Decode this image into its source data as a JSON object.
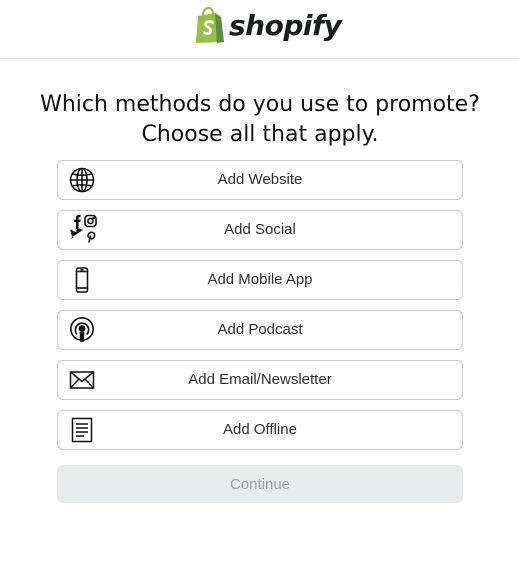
{
  "header": {
    "logo_text": "shopify"
  },
  "question": "Which methods do you use to promote? Choose all that apply.",
  "options": [
    {
      "label": "Add Website",
      "icon": "globe-icon"
    },
    {
      "label": "Add Social",
      "icon": "social-icons"
    },
    {
      "label": "Add Mobile App",
      "icon": "mobile-phone-icon"
    },
    {
      "label": "Add Podcast",
      "icon": "podcast-icon"
    },
    {
      "label": "Add Email/Newsletter",
      "icon": "envelope-icon"
    },
    {
      "label": "Add Offline",
      "icon": "document-icon"
    }
  ],
  "continue_label": "Continue",
  "colors": {
    "brand_green": "#95bf47",
    "brand_dark_green": "#5e8e3e",
    "border": "#c9cccf",
    "disabled_bg": "#e9eaeb",
    "disabled_text": "#9ca0a4"
  }
}
